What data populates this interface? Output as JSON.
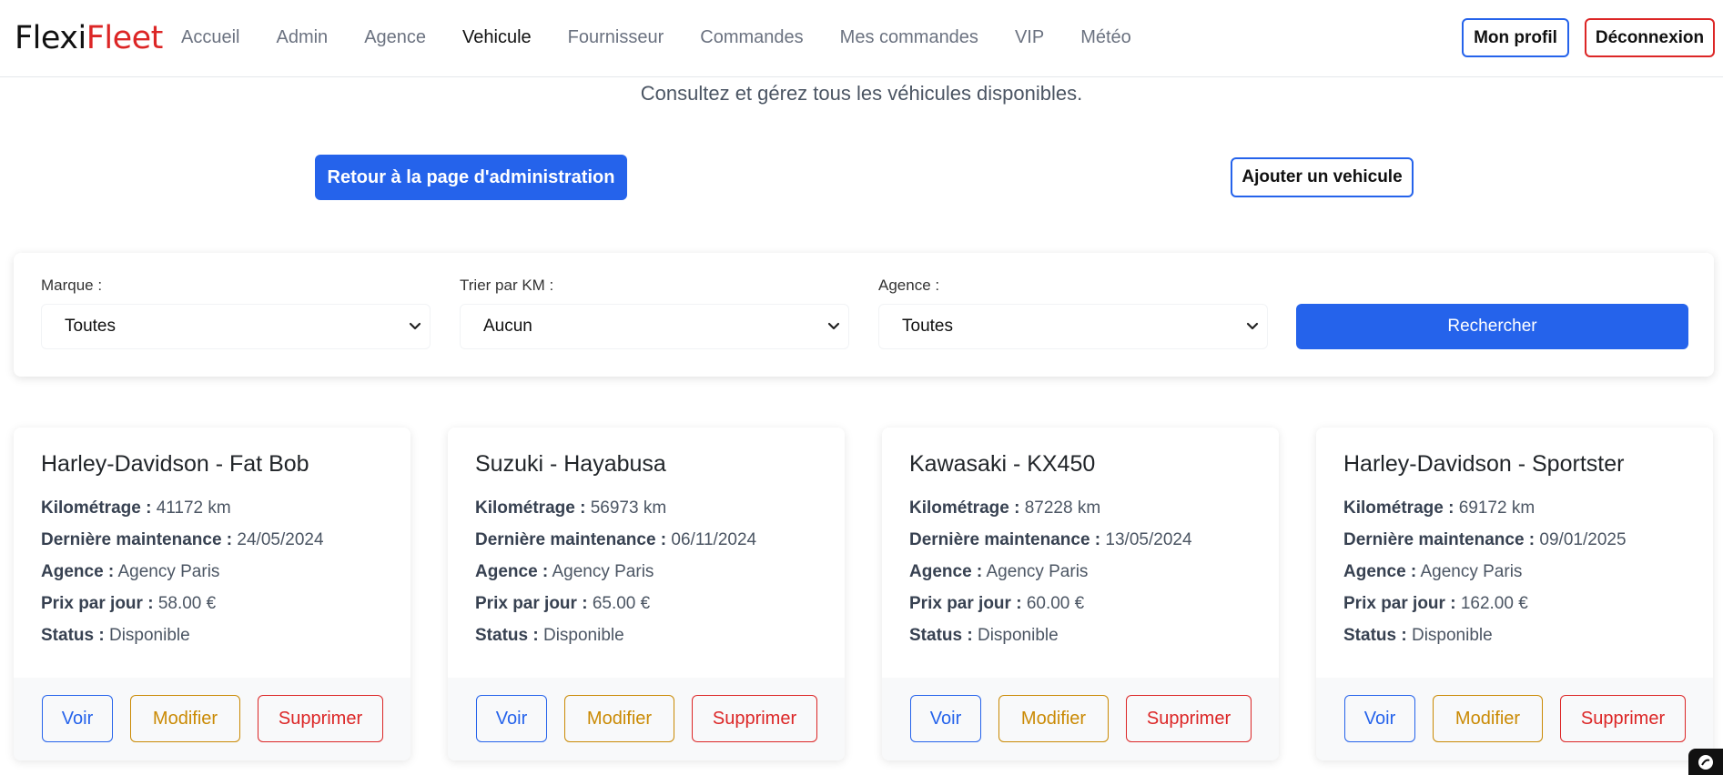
{
  "navbar": {
    "brand_part1": "Flexi",
    "brand_part2": "Fleet",
    "links": [
      "Accueil",
      "Admin",
      "Agence",
      "Vehicule",
      "Fournisseur",
      "Commandes",
      "Mes commandes",
      "VIP",
      "Météo"
    ],
    "active_link": "Vehicule",
    "profile_label": "Mon profil",
    "logout_label": "Déconnexion"
  },
  "page": {
    "subtitle": "Consultez et gérez tous les véhicules disponibles.",
    "back_label": "Retour à la page d'administration",
    "add_label": "Ajouter un vehicule"
  },
  "filters": {
    "brand_label": "Marque :",
    "brand_value": "Toutes",
    "km_label": "Trier par KM :",
    "km_value": "Aucun",
    "agency_label": "Agence :",
    "agency_value": "Toutes",
    "search_label": "Rechercher"
  },
  "labels": {
    "km": "Kilométrage :",
    "maintenance": "Dernière maintenance :",
    "agency": "Agence :",
    "price": "Prix par jour :",
    "status": "Status :",
    "view": "Voir",
    "edit": "Modifier",
    "delete": "Supprimer"
  },
  "vehicles": [
    {
      "title": "Harley-Davidson - Fat Bob",
      "km": "41172 km",
      "maintenance": "24/05/2024",
      "agency": "Agency Paris",
      "price": "58.00 €",
      "status": "Disponible"
    },
    {
      "title": "Suzuki - Hayabusa",
      "km": "56973 km",
      "maintenance": "06/11/2024",
      "agency": "Agency Paris",
      "price": "65.00 €",
      "status": "Disponible"
    },
    {
      "title": "Kawasaki - KX450",
      "km": "87228 km",
      "maintenance": "13/05/2024",
      "agency": "Agency Paris",
      "price": "60.00 €",
      "status": "Disponible"
    },
    {
      "title": "Harley-Davidson - Sportster",
      "km": "69172 km",
      "maintenance": "09/01/2025",
      "agency": "Agency Paris",
      "price": "162.00 €",
      "status": "Disponible"
    }
  ],
  "colors": {
    "primary": "#2563eb",
    "danger": "#dc2626",
    "warning": "#ca8a04"
  }
}
